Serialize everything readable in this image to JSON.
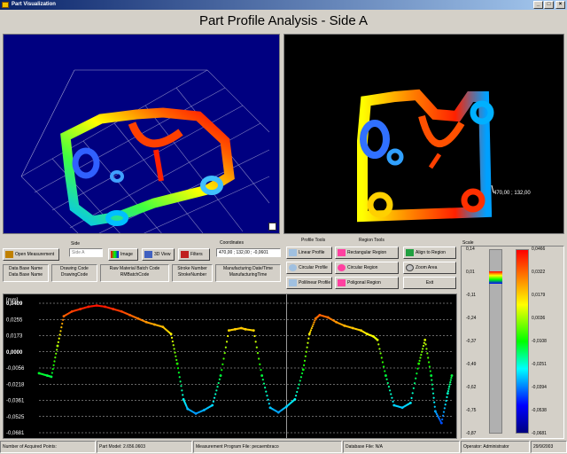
{
  "window": {
    "title": "Part Visualization",
    "min": "_",
    "max": "□",
    "close": "×"
  },
  "app_title": "Part Profile Analysis - Side A",
  "view2d": {
    "coord_label": "470,00 ; 132,00"
  },
  "side": {
    "label": "Side",
    "value": "Side A"
  },
  "coordinates": {
    "label": "Coordinates",
    "value": "470,00 ; 132,00 ; -0,0601"
  },
  "buttons": {
    "open_measurement": "Open Measurement",
    "image": "Image",
    "view3d": "3D View",
    "filters": "Filters",
    "align_to_region": "Align to Region",
    "zoom_area": "Zoom Area",
    "exit": "Exit"
  },
  "profile_tools": {
    "header": "Profile Tools",
    "linear": "Linear Profile",
    "circular": "Circular Profile",
    "polilinear": "Polilinear Profile"
  },
  "region_tools": {
    "header": "Region Tools",
    "rectangular": "Rectangular Region",
    "circular": "Circular Region",
    "polygonal": "Poligonal Region"
  },
  "info": {
    "database": {
      "label": "Data Base Name",
      "value": "Data Base Name"
    },
    "drawing": {
      "label": "Drawing Code",
      "value": "DrawingCode"
    },
    "raw_material": {
      "label": "Raw Material Batch Code",
      "value": "RMBatchCode"
    },
    "stroke": {
      "label": "Stroke Number",
      "value": "StrokeNumber"
    },
    "manufacturing": {
      "label": "Manufacturing Date/Time",
      "value": "ManufacturingTime"
    }
  },
  "scale": {
    "title": "Scale",
    "left_ticks": [
      "0,14",
      "0,01",
      "-0,11",
      "-0,24",
      "-0,37",
      "-0,49",
      "-0,62",
      "-0,75",
      "-0,87"
    ],
    "right_ticks": [
      "0,0466",
      "0,0322",
      "0,0179",
      "0,0036",
      "-0,0108",
      "-0,0251",
      "-0,0394",
      "-0,0538",
      "-0,0681"
    ]
  },
  "colors": {
    "bg": "#d4d0c8",
    "title_blue": "#0a246a",
    "view3d_bg": "#000080",
    "chart_grid": "#cccccc"
  },
  "chart_data": {
    "type": "scatter",
    "ylabel": "[mm]",
    "ylim": [
      -0.0681,
      0.0409
    ],
    "yticks": [
      "0,0409",
      "0,0255",
      "0,0173",
      "0,0000",
      "-0,0056",
      "-0,0218",
      "-0,0361",
      "-0,0525",
      "-0,0681"
    ],
    "grid": true,
    "cursor_x": 0.6,
    "x": [
      0.0,
      0.02,
      0.03,
      0.045,
      0.06,
      0.08,
      0.1,
      0.12,
      0.14,
      0.16,
      0.18,
      0.2,
      0.22,
      0.24,
      0.26,
      0.28,
      0.3,
      0.32,
      0.335,
      0.35,
      0.36,
      0.38,
      0.4,
      0.42,
      0.44,
      0.46,
      0.475,
      0.49,
      0.5,
      0.52,
      0.54,
      0.56,
      0.58,
      0.6,
      0.62,
      0.64,
      0.655,
      0.67,
      0.68,
      0.7,
      0.72,
      0.74,
      0.76,
      0.78,
      0.795,
      0.81,
      0.82,
      0.84,
      0.86,
      0.88,
      0.9,
      0.92,
      0.935,
      0.95,
      0.96,
      0.975,
      0.99,
      1.0
    ],
    "y": [
      -0.018,
      -0.02,
      -0.021,
      0.005,
      0.03,
      0.034,
      0.036,
      0.038,
      0.039,
      0.038,
      0.036,
      0.034,
      0.031,
      0.028,
      0.025,
      0.023,
      0.021,
      0.015,
      -0.01,
      -0.04,
      -0.048,
      -0.052,
      -0.049,
      -0.045,
      -0.02,
      0.018,
      0.019,
      0.02,
      0.019,
      0.018,
      -0.02,
      -0.047,
      -0.051,
      -0.046,
      -0.04,
      -0.015,
      0.015,
      0.028,
      0.031,
      0.029,
      0.025,
      0.022,
      0.02,
      0.018,
      0.015,
      0.013,
      0.01,
      -0.02,
      -0.045,
      -0.047,
      -0.043,
      -0.01,
      0.01,
      -0.02,
      -0.05,
      -0.06,
      -0.035,
      -0.02
    ]
  },
  "status": {
    "points": "Number of Acquired Points:",
    "model": "Part Model: 2.656.0603",
    "program": "Measurement Program File: pecaembraco",
    "database": "Database File: N/A",
    "operator": "Operator: Administrator",
    "date": "29/9/2003"
  }
}
